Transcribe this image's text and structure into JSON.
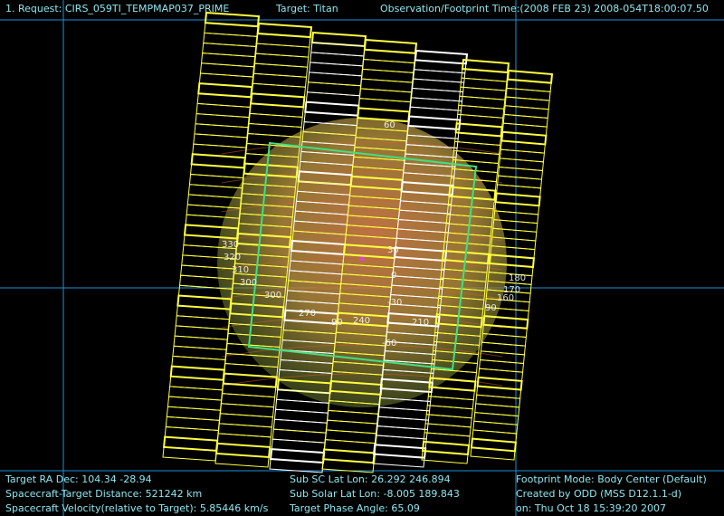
{
  "header": {
    "request": "1. Request: CIRS_059TI_TEMPMAP037_PRIME",
    "target": "Target: Titan",
    "observation_time": "Observation/Footprint Time:(2008 FEB 23) 2008-054T18:00:07.50"
  },
  "footer": {
    "left": [
      "Target RA Dec: 104.34  -28.94",
      "Spacecraft-Target Distance:  521242 km",
      "Spacecraft Velocity(relative to Target): 5.85446 km/s"
    ],
    "middle": [
      "Sub SC Lat Lon: 26.292  246.894",
      "Sub Solar Lat Lon: -8.005  189.843",
      "Target Phase Angle: 65.09"
    ],
    "right": [
      "Footprint Mode: Body Center (Default)",
      "Created by ODD (MSS D12.1.1-d)",
      "on: Thu Oct 18 15:39:20 2007"
    ]
  },
  "plot_labels": {
    "left_edge": [
      "330",
      "320",
      "310",
      "300"
    ],
    "right_edge": [
      "180",
      "170",
      "160",
      "90"
    ],
    "interior": [
      "300",
      "270",
      "240",
      "210",
      "60",
      "30",
      "0",
      "-30",
      "-60",
      "90"
    ]
  },
  "colors": {
    "text": "#8fe6f0",
    "crosshair": "#1e8fd8",
    "footprint": "#ffff40",
    "footprint_alt": "#ffffff",
    "fov_box": "#40e080",
    "planet_outer": "#9a9a3a",
    "planet_inner": "#c8804a"
  },
  "icons": {
    "subsolar_point": "magenta-dot-icon"
  }
}
